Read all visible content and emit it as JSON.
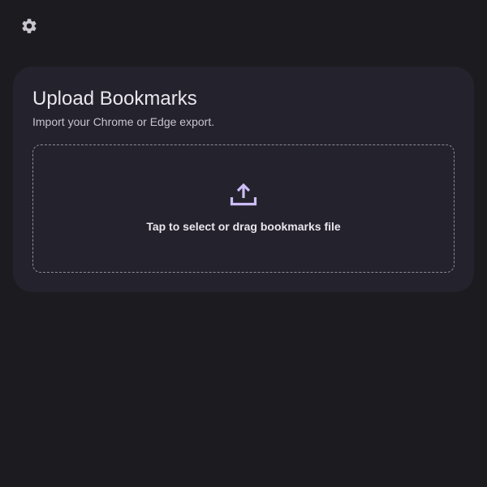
{
  "header": {
    "settings_icon": "gear-icon"
  },
  "card": {
    "title": "Upload Bookmarks",
    "subtitle": "Import your Chrome or Edge export.",
    "dropzone": {
      "icon": "upload-icon",
      "label": "Tap to select or drag bookmarks file"
    }
  },
  "colors": {
    "background": "#1c1b1f",
    "card": "#24222c",
    "accent": "#cdbdf7",
    "icon_gray": "#c9c6cf"
  }
}
